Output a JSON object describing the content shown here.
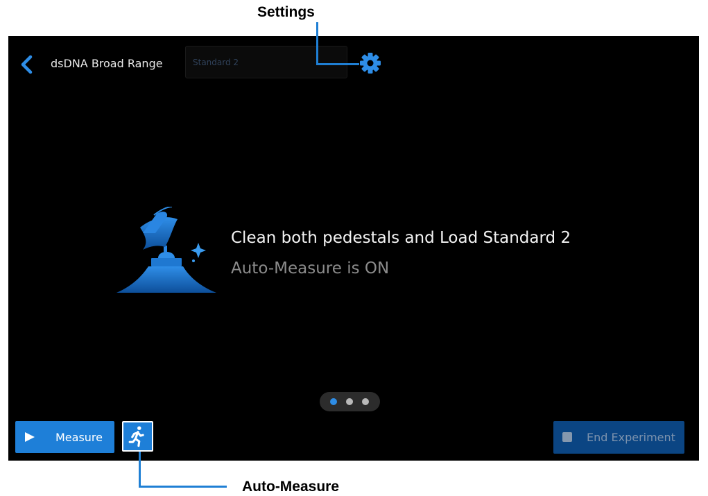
{
  "callouts": {
    "settings": "Settings",
    "auto_measure": "Auto-Measure"
  },
  "header": {
    "title": "dsDNA Broad Range",
    "standard_field": "Standard 2"
  },
  "message": {
    "main": "Clean both pedestals and Load Standard 2",
    "sub": "Auto-Measure is ON"
  },
  "pager": {
    "count": 3,
    "active": 1
  },
  "buttons": {
    "measure": "Measure",
    "end": "End Experiment"
  },
  "colors": {
    "accent": "#1e7fd8",
    "callout_line": "#1f7fd4",
    "background": "#000000"
  },
  "icons": [
    "back-chevron-icon",
    "gear-icon",
    "play-icon",
    "running-person-icon",
    "stop-square-icon",
    "pedestal-cleaning-illustration"
  ]
}
